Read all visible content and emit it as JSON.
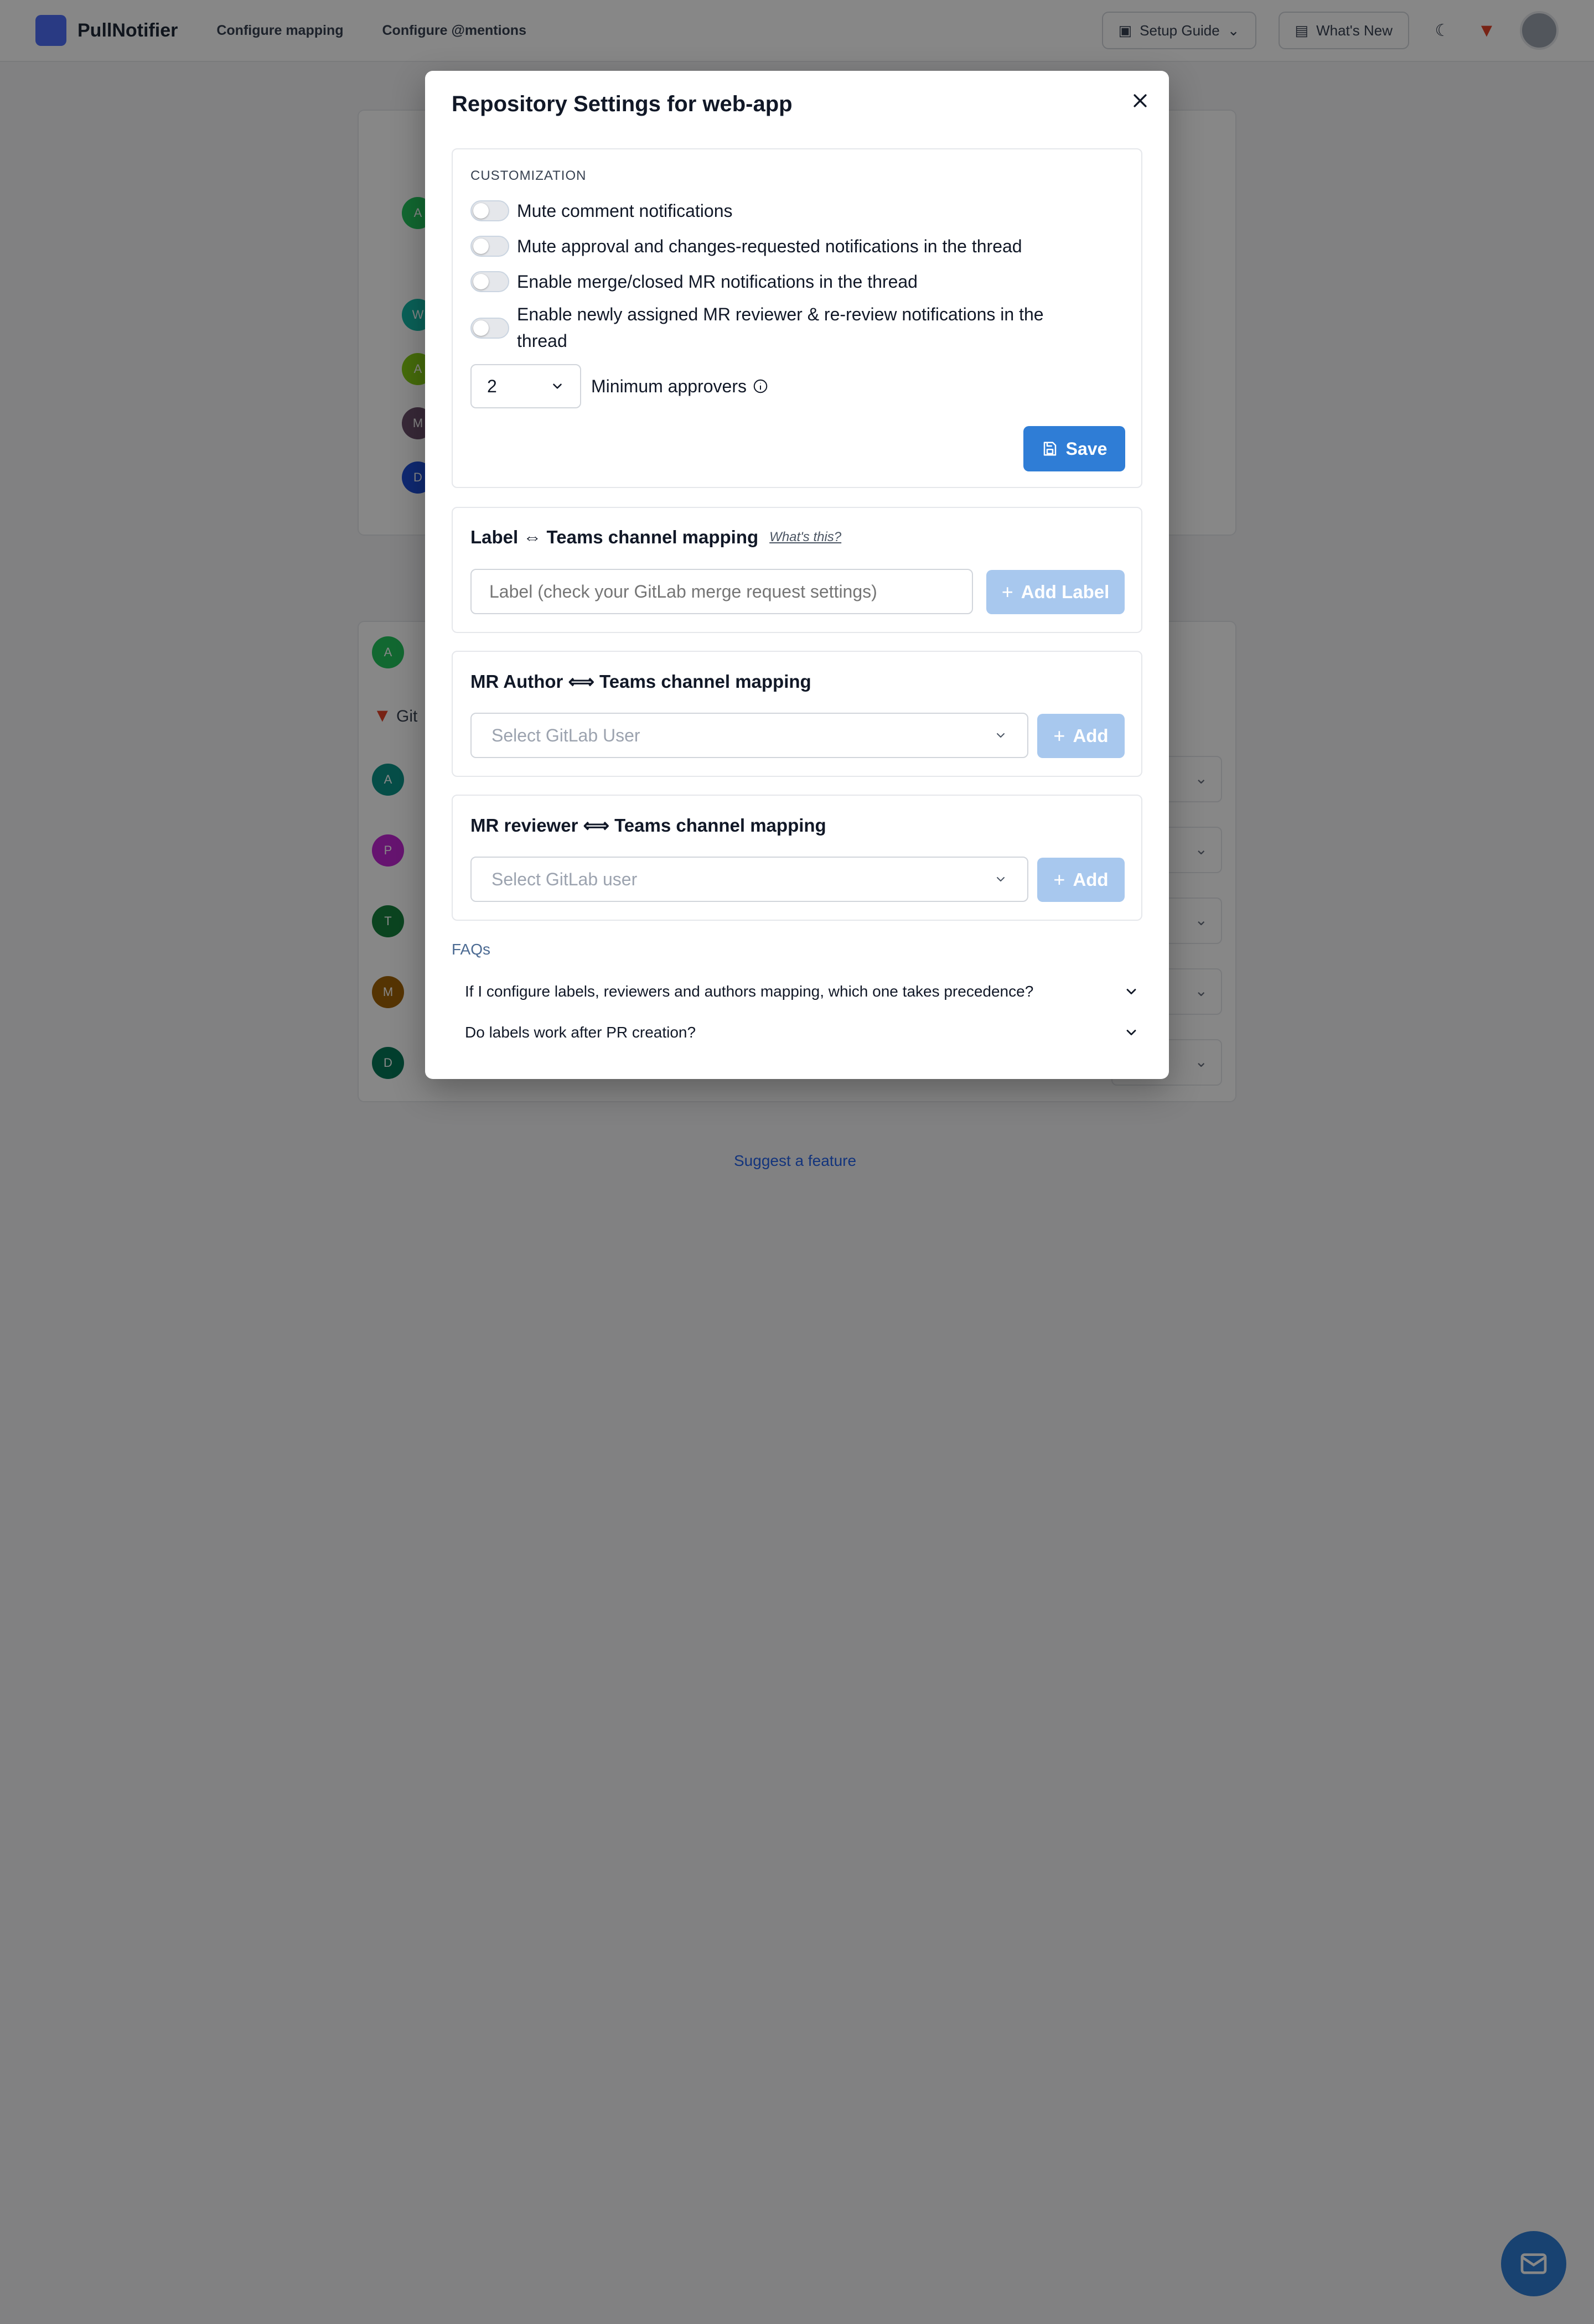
{
  "app": {
    "brand": "PullNotifier",
    "nav_links": [
      "Configure mapping",
      "Configure @mentions"
    ],
    "setup_guide": "Setup Guide",
    "whats_new": "What's New",
    "suggest_feature": "Suggest a feature"
  },
  "background": {
    "avatar_letters": [
      "A",
      "W",
      "A",
      "M",
      "D"
    ],
    "list_letters": [
      "A",
      "A",
      "P",
      "T",
      "M",
      "D"
    ],
    "gitlab_label": "Git"
  },
  "modal": {
    "title": "Repository Settings for web-app",
    "customization": {
      "label": "CUSTOMIZATION",
      "toggles": [
        "Mute comment notifications",
        "Mute approval and changes-requested notifications in the thread",
        "Enable merge/closed MR notifications in the thread",
        "Enable newly assigned MR reviewer & re-review notifications in the thread"
      ],
      "min_approvers_value": "2",
      "min_approvers_label": "Minimum approvers",
      "save_label": "Save"
    },
    "label_mapping": {
      "title": "Label ⇔ Teams channel mapping",
      "whats_this": "What's this?",
      "placeholder": "Label (check your GitLab merge request settings)",
      "add_label": "Add Label"
    },
    "author_mapping": {
      "title": "MR Author ⟺ Teams channel mapping",
      "placeholder": "Select GitLab User",
      "add": "Add"
    },
    "reviewer_mapping": {
      "title": "MR reviewer ⟺ Teams channel mapping",
      "placeholder": "Select GitLab user",
      "add": "Add"
    },
    "faqs": {
      "heading": "FAQs",
      "items": [
        "If I configure labels, reviewers and authors mapping, which one takes precedence?",
        "Do labels work after PR creation?"
      ]
    }
  },
  "colors": {
    "primary": "#2f7dd6",
    "primary_disabled": "#a8c8ee",
    "overlay": "rgba(0,0,0,0.47)"
  }
}
